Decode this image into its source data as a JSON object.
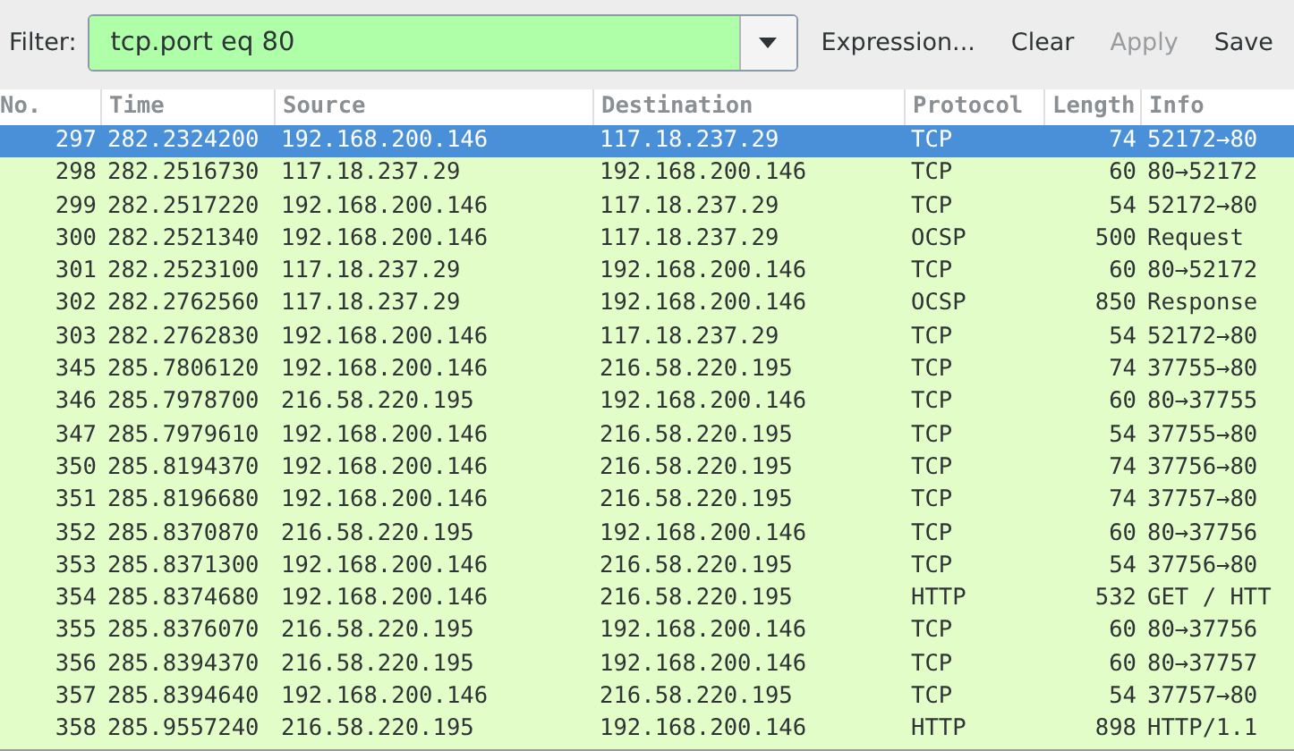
{
  "filter_bar": {
    "label": "Filter:",
    "value": "tcp.port eq 80",
    "buttons": [
      {
        "label": "Expression...",
        "disabled": false
      },
      {
        "label": "Clear",
        "disabled": false
      },
      {
        "label": "Apply",
        "disabled": true
      },
      {
        "label": "Save",
        "disabled": false
      }
    ]
  },
  "packet_list": {
    "columns": [
      "No.",
      "Time",
      "Source",
      "Destination",
      "Protocol",
      "Length",
      "Info"
    ],
    "rows": [
      {
        "no": "297",
        "time": "282.2324200",
        "source": "192.168.200.146",
        "destination": "117.18.237.29",
        "protocol": "TCP",
        "length": "74",
        "info": "52172→80",
        "selected": true
      },
      {
        "no": "298",
        "time": "282.2516730",
        "source": "117.18.237.29",
        "destination": "192.168.200.146",
        "protocol": "TCP",
        "length": "60",
        "info": "80→52172",
        "selected": false
      },
      {
        "no": "299",
        "time": "282.2517220",
        "source": "192.168.200.146",
        "destination": "117.18.237.29",
        "protocol": "TCP",
        "length": "54",
        "info": "52172→80",
        "selected": false
      },
      {
        "no": "300",
        "time": "282.2521340",
        "source": "192.168.200.146",
        "destination": "117.18.237.29",
        "protocol": "OCSP",
        "length": "500",
        "info": "Request",
        "selected": false
      },
      {
        "no": "301",
        "time": "282.2523100",
        "source": "117.18.237.29",
        "destination": "192.168.200.146",
        "protocol": "TCP",
        "length": "60",
        "info": "80→52172",
        "selected": false
      },
      {
        "no": "302",
        "time": "282.2762560",
        "source": "117.18.237.29",
        "destination": "192.168.200.146",
        "protocol": "OCSP",
        "length": "850",
        "info": "Response",
        "selected": false
      },
      {
        "no": "303",
        "time": "282.2762830",
        "source": "192.168.200.146",
        "destination": "117.18.237.29",
        "protocol": "TCP",
        "length": "54",
        "info": "52172→80",
        "selected": false
      },
      {
        "no": "345",
        "time": "285.7806120",
        "source": "192.168.200.146",
        "destination": "216.58.220.195",
        "protocol": "TCP",
        "length": "74",
        "info": "37755→80",
        "selected": false
      },
      {
        "no": "346",
        "time": "285.7978700",
        "source": "216.58.220.195",
        "destination": "192.168.200.146",
        "protocol": "TCP",
        "length": "60",
        "info": "80→37755",
        "selected": false
      },
      {
        "no": "347",
        "time": "285.7979610",
        "source": "192.168.200.146",
        "destination": "216.58.220.195",
        "protocol": "TCP",
        "length": "54",
        "info": "37755→80",
        "selected": false
      },
      {
        "no": "350",
        "time": "285.8194370",
        "source": "192.168.200.146",
        "destination": "216.58.220.195",
        "protocol": "TCP",
        "length": "74",
        "info": "37756→80",
        "selected": false
      },
      {
        "no": "351",
        "time": "285.8196680",
        "source": "192.168.200.146",
        "destination": "216.58.220.195",
        "protocol": "TCP",
        "length": "74",
        "info": "37757→80",
        "selected": false
      },
      {
        "no": "352",
        "time": "285.8370870",
        "source": "216.58.220.195",
        "destination": "192.168.200.146",
        "protocol": "TCP",
        "length": "60",
        "info": "80→37756",
        "selected": false
      },
      {
        "no": "353",
        "time": "285.8371300",
        "source": "192.168.200.146",
        "destination": "216.58.220.195",
        "protocol": "TCP",
        "length": "54",
        "info": "37756→80",
        "selected": false
      },
      {
        "no": "354",
        "time": "285.8374680",
        "source": "192.168.200.146",
        "destination": "216.58.220.195",
        "protocol": "HTTP",
        "length": "532",
        "info": "GET / HTT",
        "selected": false
      },
      {
        "no": "355",
        "time": "285.8376070",
        "source": "216.58.220.195",
        "destination": "192.168.200.146",
        "protocol": "TCP",
        "length": "60",
        "info": "80→37756",
        "selected": false
      },
      {
        "no": "356",
        "time": "285.8394370",
        "source": "216.58.220.195",
        "destination": "192.168.200.146",
        "protocol": "TCP",
        "length": "60",
        "info": "80→37757",
        "selected": false
      },
      {
        "no": "357",
        "time": "285.8394640",
        "source": "192.168.200.146",
        "destination": "216.58.220.195",
        "protocol": "TCP",
        "length": "54",
        "info": "37757→80",
        "selected": false
      },
      {
        "no": "358",
        "time": "285.9557240",
        "source": "216.58.220.195",
        "destination": "192.168.200.146",
        "protocol": "HTTP",
        "length": "898",
        "info": "HTTP/1.1",
        "selected": false
      }
    ]
  }
}
